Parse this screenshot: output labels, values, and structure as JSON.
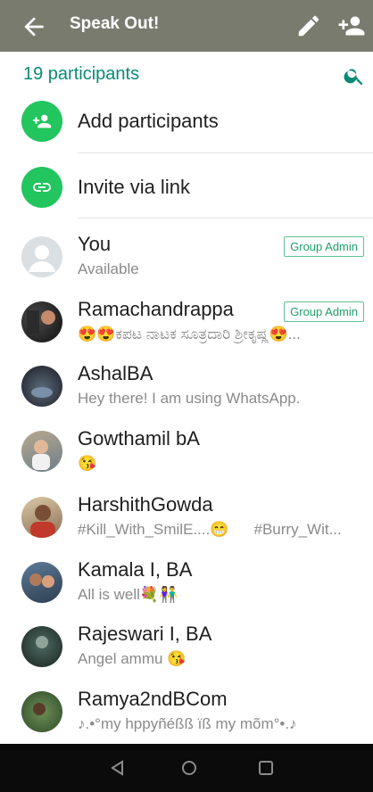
{
  "appbar": {
    "title": "Speak Out!"
  },
  "header": {
    "count_label": "19 participants"
  },
  "actions": {
    "add_label": "Add participants",
    "invite_label": "Invite via link"
  },
  "members": [
    {
      "name": "You",
      "status": "Available",
      "badge": "Group Admin"
    },
    {
      "name": "Ramachandrappa",
      "status": "😍😍ಕಪಟ ನಾಟಕ ಸೂತ್ರದಾರಿ ಶ್ರೀಕೃಷ್ಣ😍...",
      "badge": "Group Admin"
    },
    {
      "name": "AshalBA",
      "status": "Hey there! I am using WhatsApp."
    },
    {
      "name": "Gowthamil bA",
      "status": "😘"
    },
    {
      "name": "HarshithGowda",
      "status": "#Kill_With_SmilE....😁",
      "status_extra": "#Burry_Wit..."
    },
    {
      "name": "Kamala I, BA",
      "status": "All is well💐👫"
    },
    {
      "name": "Rajeswari I, BA",
      "status": "Angel ammu 😘"
    },
    {
      "name": "Ramya2ndBCom",
      "status": "♪.•°my hppyñéßß ïß my mõm°•.♪"
    }
  ],
  "colors": {
    "appbar": "#7a7b6f",
    "accent": "#0a8a75",
    "action_circle": "#22c55e"
  }
}
